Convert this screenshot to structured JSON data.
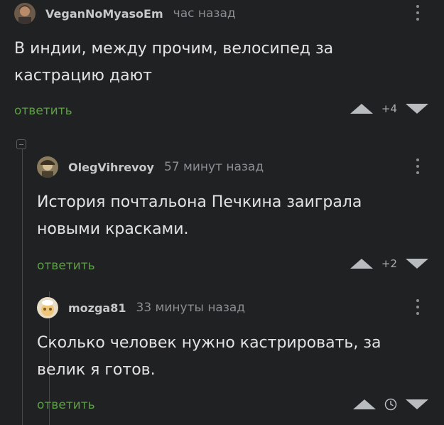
{
  "comments": [
    {
      "username": "VeganNoMyasoEm",
      "time": "час назад",
      "text_lines": [
        "В индии, между прочим, велосипед за",
        "кастрацию дают"
      ],
      "reply_label": "ответить",
      "score": "+4"
    },
    {
      "username": "OlegVihrevoy",
      "time": "57 минут назад",
      "text_lines": [
        "История почтальона Печкина заиграла",
        "новыми красками."
      ],
      "reply_label": "ответить",
      "score": "+2"
    },
    {
      "username": "mozga81",
      "time": "33 минуты назад",
      "text_lines": [
        "Сколько человек нужно кастрировать, за",
        "велик я готов."
      ],
      "reply_label": "ответить",
      "score_icon": "clock-icon"
    }
  ],
  "icons": {
    "upvote": "upvote-arrow-icon",
    "downvote": "downvote-arrow-icon",
    "more": "more-vertical-icon",
    "collapse": "collapse-thread-icon"
  },
  "colors": {
    "background": "#1f2123",
    "reply": "#5e9e46",
    "text": "#e3e3e3",
    "muted": "#8b8f92"
  }
}
